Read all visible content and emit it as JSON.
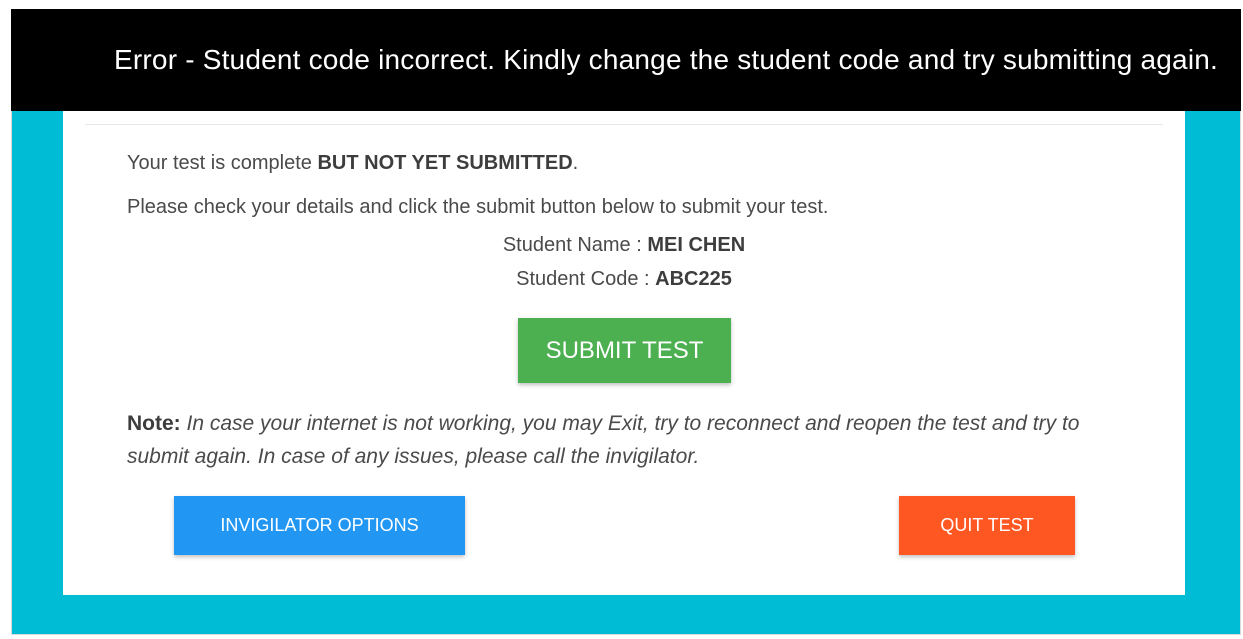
{
  "error_banner": {
    "text": "Error - Student code incorrect. Kindly change the student code and try submitting again."
  },
  "status": {
    "line1_prefix": "Your test is complete ",
    "line1_emphasis": "BUT NOT YET SUBMITTED",
    "line1_suffix": ".",
    "line2": "Please check your details and click the submit button below to submit your test."
  },
  "student": {
    "name_label": "Student Name : ",
    "name_value": "MEI CHEN",
    "code_label": "Student Code : ",
    "code_value": "ABC225"
  },
  "submit_label": "SUBMIT TEST",
  "note": {
    "label": "Note:",
    "text": " In case your internet is not working, you may Exit, try to reconnect and reopen the test and try to submit again. In case of any issues, please call the invigilator."
  },
  "actions": {
    "invigilator_label": "INVIGILATOR OPTIONS",
    "quit_label": "QUIT TEST"
  },
  "colors": {
    "background": "#00bcd4",
    "error_bar": "#000000",
    "submit": "#4caf50",
    "invigilator": "#2196f3",
    "quit": "#ff5722"
  }
}
